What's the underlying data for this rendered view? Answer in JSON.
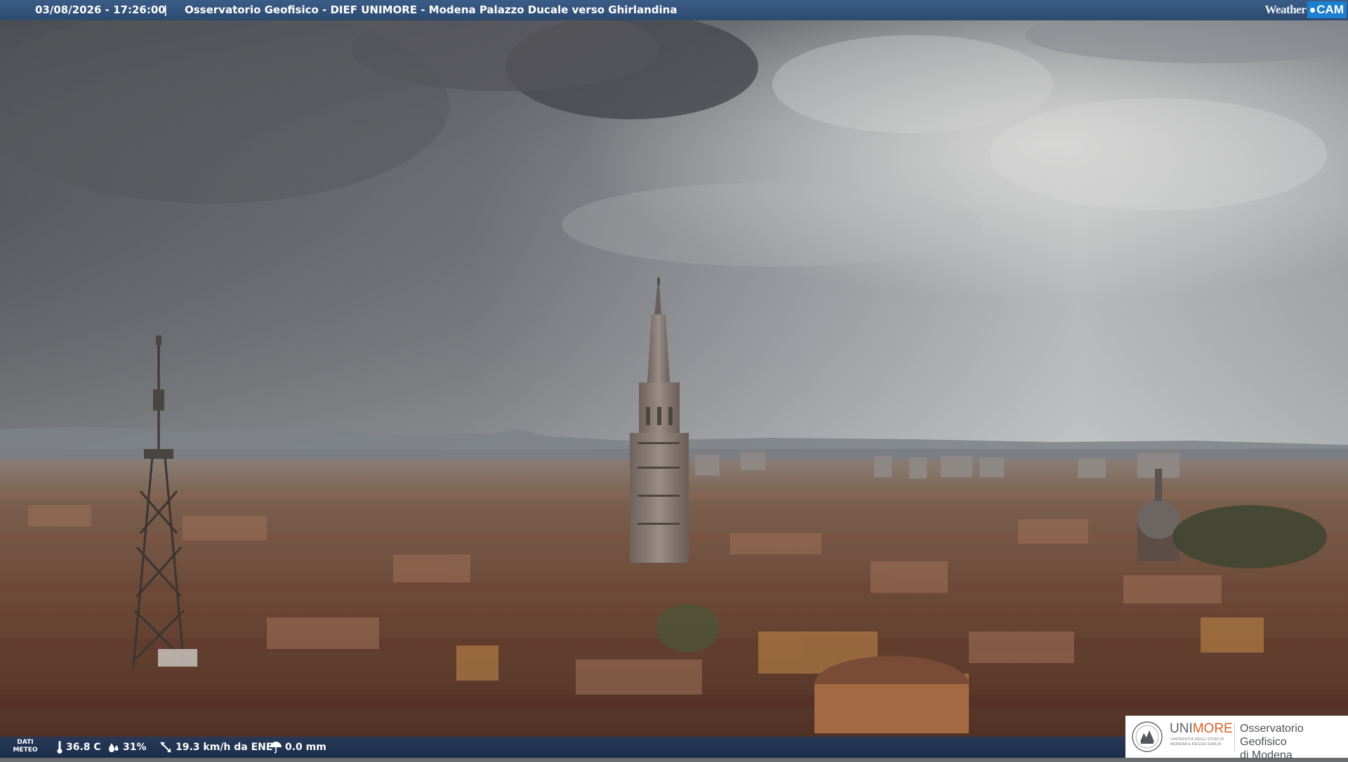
{
  "caption": {
    "timestamp": "03/08/2026 - 17:26:00",
    "separator": "|",
    "title": "Osservatorio Geofisico - DIEF UNIMORE - Modena Palazzo Ducale verso Ghirlandina"
  },
  "brand": {
    "weather": "Weather",
    "cam": "CAM"
  },
  "weather": {
    "dati_line1": "DATI",
    "dati_line2": "METEO",
    "temperature": "36.8 C",
    "humidity": "31%",
    "wind": "19.3 km/h da ENE",
    "rain": "0.0 mm"
  },
  "logo": {
    "uni_a": "UNI",
    "uni_b": "MORE",
    "uni_sub": "UNIVERSITÀ DEGLI STUDI DI MODENA E REGGIO EMILIA",
    "observatory_line1": "Osservatorio Geofisico",
    "observatory_line2": "di Modena"
  },
  "colors": {
    "bar": "#2d4a70",
    "cam_blue": "#1c7fd0",
    "unimore_orange": "#d9602a"
  }
}
